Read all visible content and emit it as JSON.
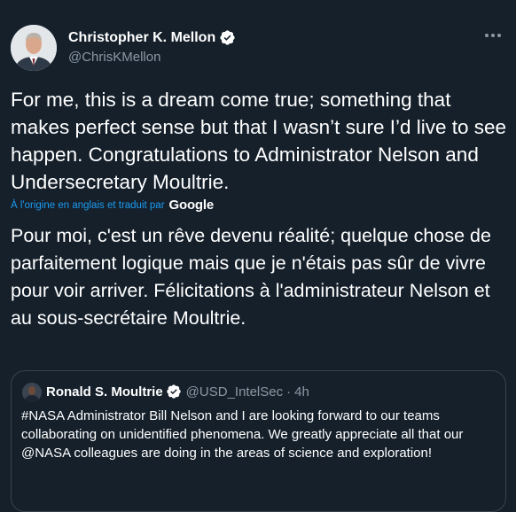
{
  "author": {
    "name": "Christopher K. Mellon",
    "handle": "@ChrisKMellon",
    "verified": true
  },
  "tweet": {
    "text": "For me, this is a dream come true; something that makes perfect sense but that I wasn’t sure I’d live to see happen. Congratulations to Administrator Nelson and Undersecretary Moultrie.",
    "translation_notice": "À l'origine en anglais et traduit par",
    "translation_provider": "Google",
    "translated_text": "Pour moi, c'est un rêve devenu réalité; quelque chose de parfaitement logique mais que je n'étais pas sûr de vivre pour voir arriver. Félicitations à l'administrateur Nelson et au sous-secrétaire Moultrie."
  },
  "quoted_tweet": {
    "name": "Ronald S. Moultrie",
    "handle": "@USD_IntelSec",
    "separator": "·",
    "time": "4h",
    "verified": true,
    "text": "#NASA Administrator Bill Nelson and I are looking forward to our teams collaborating on unidentified phenomena. We greatly appreciate all that our @NASA colleagues are doing in the areas of science and exploration!"
  },
  "icons": {
    "verified": "verified-badge-icon",
    "more": "more-options-icon"
  },
  "colors": {
    "background": "#15202b",
    "accent": "#1d9bf0",
    "secondary_text": "#8b98a5",
    "border": "#38444d"
  }
}
